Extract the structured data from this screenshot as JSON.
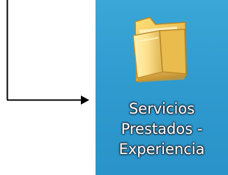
{
  "desktop": {
    "colors": {
      "background": "#2f9bcf",
      "label_text": "#ffffff",
      "arrow": "#000000"
    },
    "folder": {
      "icon": "folder-icon",
      "label_lines": [
        "Servicios",
        "Prestados -",
        "Experiencia"
      ]
    },
    "annotation": {
      "icon": "arrow-icon"
    }
  }
}
